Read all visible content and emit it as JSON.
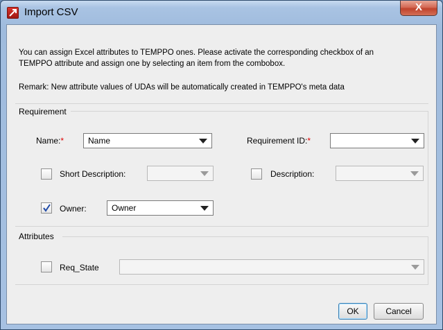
{
  "window": {
    "title": "Import CSV",
    "close_label": "X"
  },
  "intro": {
    "line1": "You can assign Excel attributes to TEMPPO ones. Please activate the corresponding checkbox of an",
    "line2": "TEMPPO attribute and assign one by selecting an item from the combobox.",
    "remark": "Remark: New attribute values of UDAs will be automatically created in TEMPPO's meta data"
  },
  "requirement": {
    "section_label": "Requirement",
    "name": {
      "label": "Name:",
      "required_mark": "*",
      "value": "Name"
    },
    "requirement_id": {
      "label": "Requirement ID:",
      "required_mark": "*",
      "value": ""
    },
    "short_description": {
      "label": "Short Description:",
      "checked": false,
      "value": ""
    },
    "description": {
      "label": "Description:",
      "checked": false,
      "value": ""
    },
    "owner": {
      "label": "Owner:",
      "checked": true,
      "value": "Owner"
    }
  },
  "attributes": {
    "section_label": "Attributes",
    "req_state": {
      "label": "Req_State",
      "checked": false,
      "value": ""
    }
  },
  "buttons": {
    "ok": "OK",
    "cancel": "Cancel"
  }
}
